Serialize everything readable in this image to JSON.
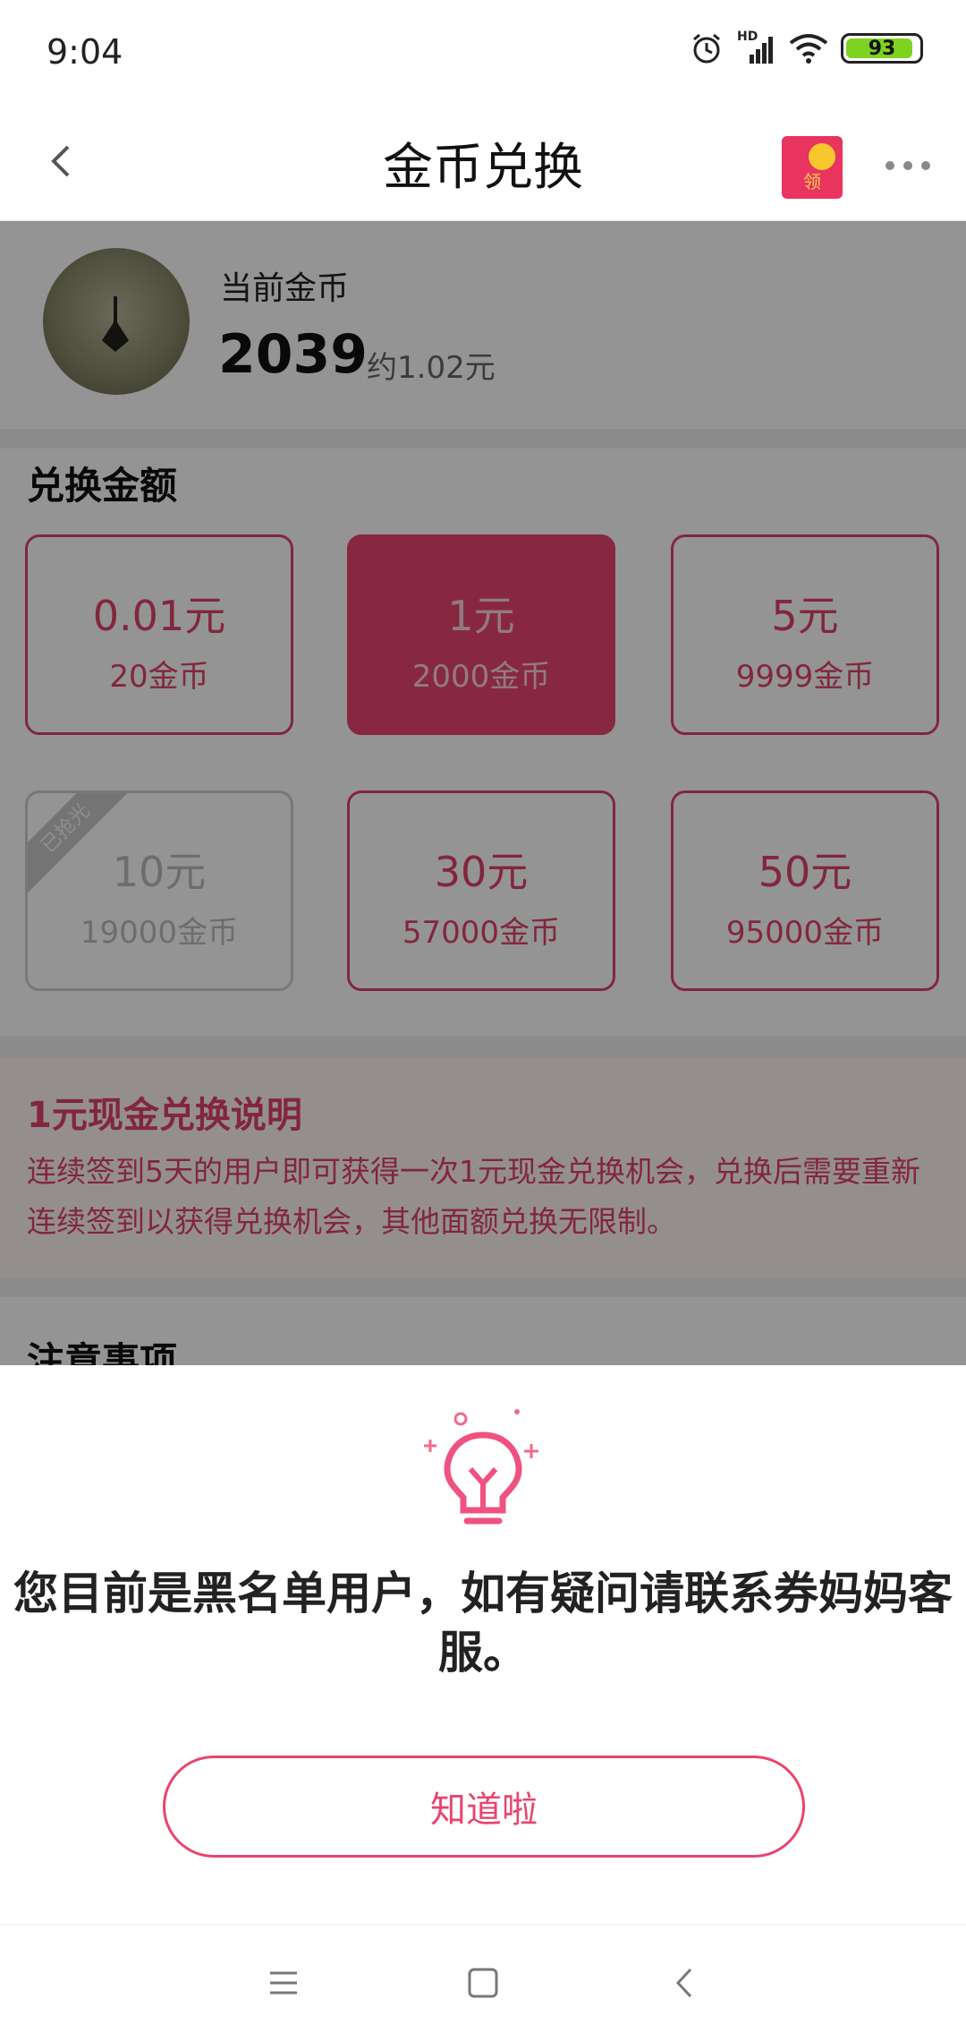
{
  "status_bar": {
    "time": "9:04",
    "hd_label": "HD",
    "battery": "93",
    "battery_level": 0.93,
    "icons": [
      "alarm-icon",
      "signal-icon",
      "wifi-icon",
      "battery-icon"
    ]
  },
  "header": {
    "title": "金币兑换",
    "back_icon": "chevron-left-icon",
    "redpacket_label": "领",
    "more_icon": "more-icon"
  },
  "profile": {
    "current_label": "当前金币",
    "coins": "2039",
    "approx": "约1.02元"
  },
  "exchange": {
    "title": "兑换金额",
    "options": [
      {
        "amount": "0.01元",
        "coins": "20金币",
        "state": "normal"
      },
      {
        "amount": "1元",
        "coins": "2000金币",
        "state": "selected"
      },
      {
        "amount": "5元",
        "coins": "9999金币",
        "state": "normal"
      },
      {
        "amount": "10元",
        "coins": "19000金币",
        "state": "sold_out",
        "badge": "已抢光"
      },
      {
        "amount": "30元",
        "coins": "57000金币",
        "state": "normal"
      },
      {
        "amount": "50元",
        "coins": "95000金币",
        "state": "normal"
      }
    ]
  },
  "notice": {
    "title": "1元现金兑换说明",
    "body": "连续签到5天的用户即可获得一次1元现金兑换机会，兑换后需要重新连续签到以获得兑换机会，其他面额兑换无限制。"
  },
  "notes": {
    "title": "注意事项"
  },
  "dialog": {
    "icon": "lightbulb-icon",
    "message": "您目前是黑名单用户，如有疑问请联系券妈妈客服。",
    "button": "知道啦"
  },
  "system_nav": {
    "icons": [
      "menu-icon",
      "home-icon",
      "back-icon"
    ]
  },
  "colors": {
    "accent": "#e8456f",
    "overlay": "rgba(0,0,0,0.42)"
  }
}
